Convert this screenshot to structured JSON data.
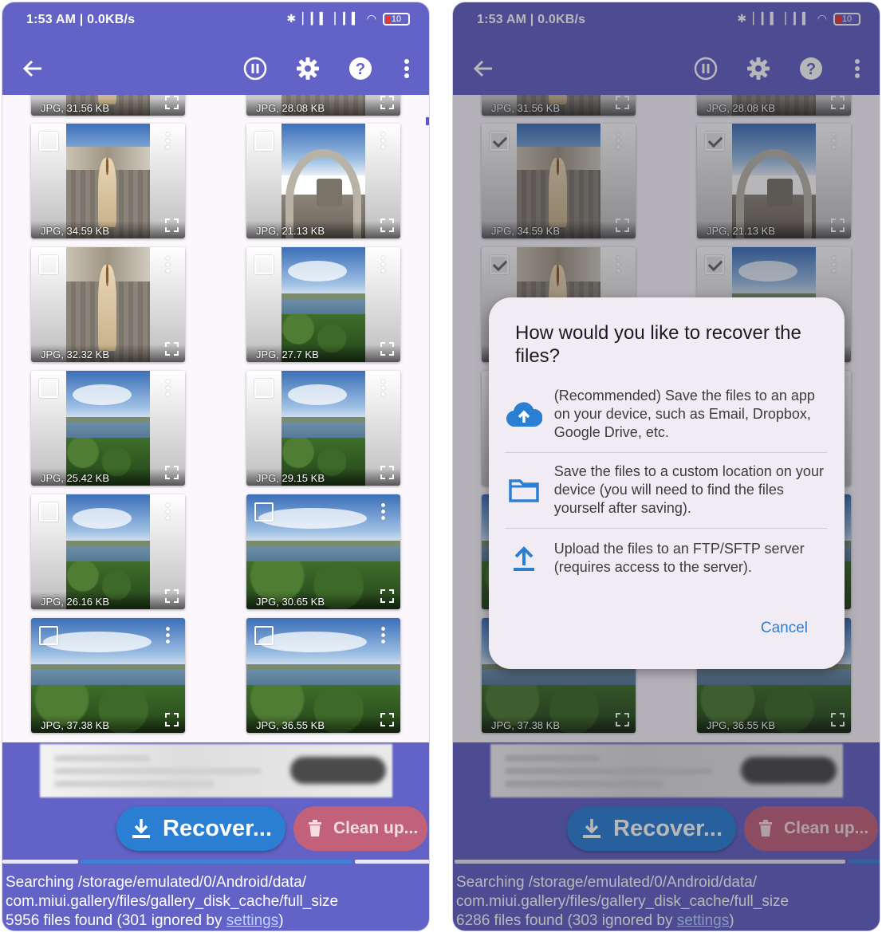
{
  "status": {
    "time_speed": "1:53 AM | 0.0KB/s",
    "battery": "10"
  },
  "tile_labels": {
    "t0a": "JPG, 31.56 KB",
    "t0b": "JPG, 28.08 KB",
    "t1a": "JPG, 34.59 KB",
    "t1b": "JPG, 21.13 KB",
    "t2a": "JPG, 32.32 KB",
    "t2b": "JPG, 27.7 KB",
    "t3a": "JPG, 25.42 KB",
    "t3b": "JPG, 29.15 KB",
    "t4a": "JPG, 26.16 KB",
    "t4b": "JPG, 30.65 KB",
    "t5a": "JPG, 37.38 KB",
    "t5b": "JPG, 36.55 KB"
  },
  "actions": {
    "recover": "Recover...",
    "cleanup": "Clean up..."
  },
  "left": {
    "search_line1": "Searching /storage/emulated/0/Android/data/",
    "search_line2": "com.miui.gallery/files/gallery_disk_cache/full_size",
    "found_prefix": "5956 files found (301 ignored by ",
    "settings_link": "settings",
    "found_suffix": ")"
  },
  "right": {
    "search_line1": "Searching /storage/emulated/0/Android/data/",
    "search_line2": "com.miui.gallery/files/gallery_disk_cache/full_size",
    "found_prefix": "6286 files found (303 ignored by ",
    "settings_link": "settings",
    "found_suffix": ")"
  },
  "dialog": {
    "title": "How would you like to recover the files?",
    "options": [
      {
        "icon": "cloud-upload-icon",
        "text": "(Recommended) Save the files to an app on your device, such as Email, Dropbox, Google Drive, etc."
      },
      {
        "icon": "folder-icon",
        "text": "Save the files to a custom location on your device (you will need to find the files yourself after saving)."
      },
      {
        "icon": "upload-icon",
        "text": "Upload the files to an FTP/SFTP server (requires access to the server)."
      }
    ],
    "cancel": "Cancel"
  },
  "colors": {
    "app_bar": "#6362c6",
    "recover_button": "#2b7fd3",
    "cleanup_button": "#c2627a",
    "dialog_bg": "#f1ecf4",
    "accent": "#2b7fd3"
  }
}
